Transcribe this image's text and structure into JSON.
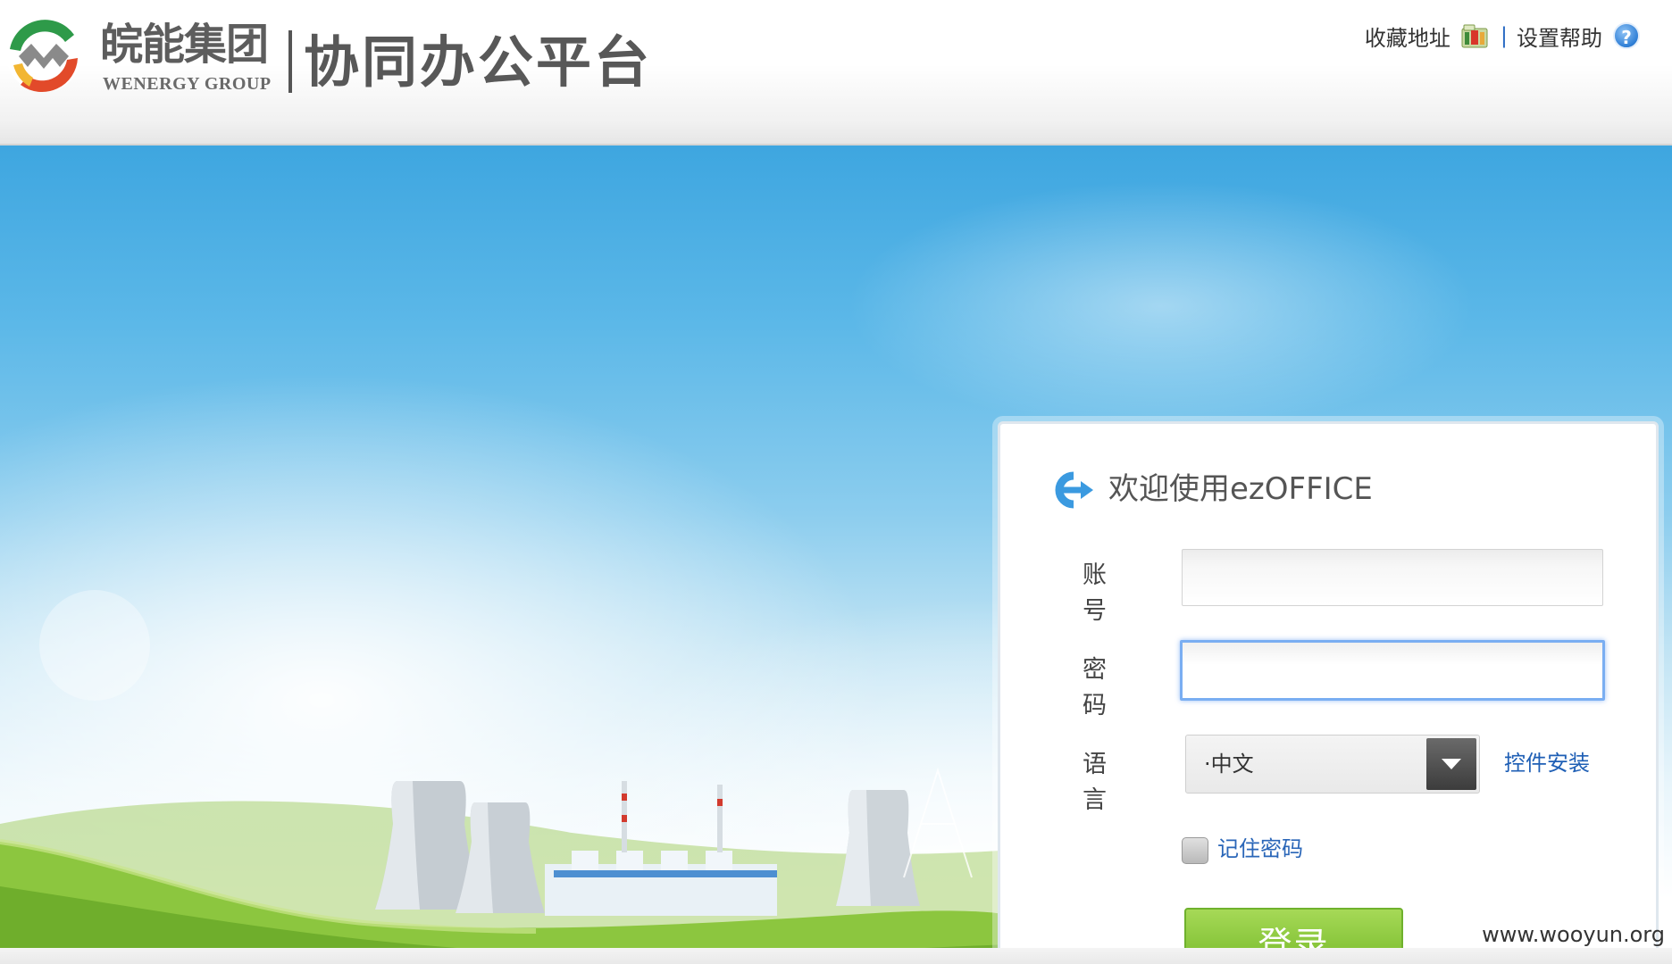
{
  "header": {
    "brand_cn": "皖能集团",
    "brand_en": "WENERGY GROUP",
    "platform_title": "协同办公平台",
    "links": {
      "favorite": "收藏地址",
      "separator": "|",
      "help": "设置帮助"
    },
    "icons": {
      "logo": "wenergy-logo-icon",
      "favorite": "bookmark-folder-icon",
      "help": "question-mark-icon"
    }
  },
  "login": {
    "welcome": "欢迎使用ezOFFICE",
    "account_label": "账号",
    "account_value": "",
    "password_label": "密码",
    "password_value": "",
    "language_label": "语言",
    "language_value": "·中文",
    "plugin_install": "控件安装",
    "remember_password": "记住密码",
    "remember_checked": false,
    "submit": "登录"
  },
  "watermark": "www.wooyun.org",
  "colors": {
    "accent_blue": "#2a66b8",
    "button_green": "#87c53a",
    "sky_blue": "#3ea6e0",
    "text_gray": "#585858"
  }
}
